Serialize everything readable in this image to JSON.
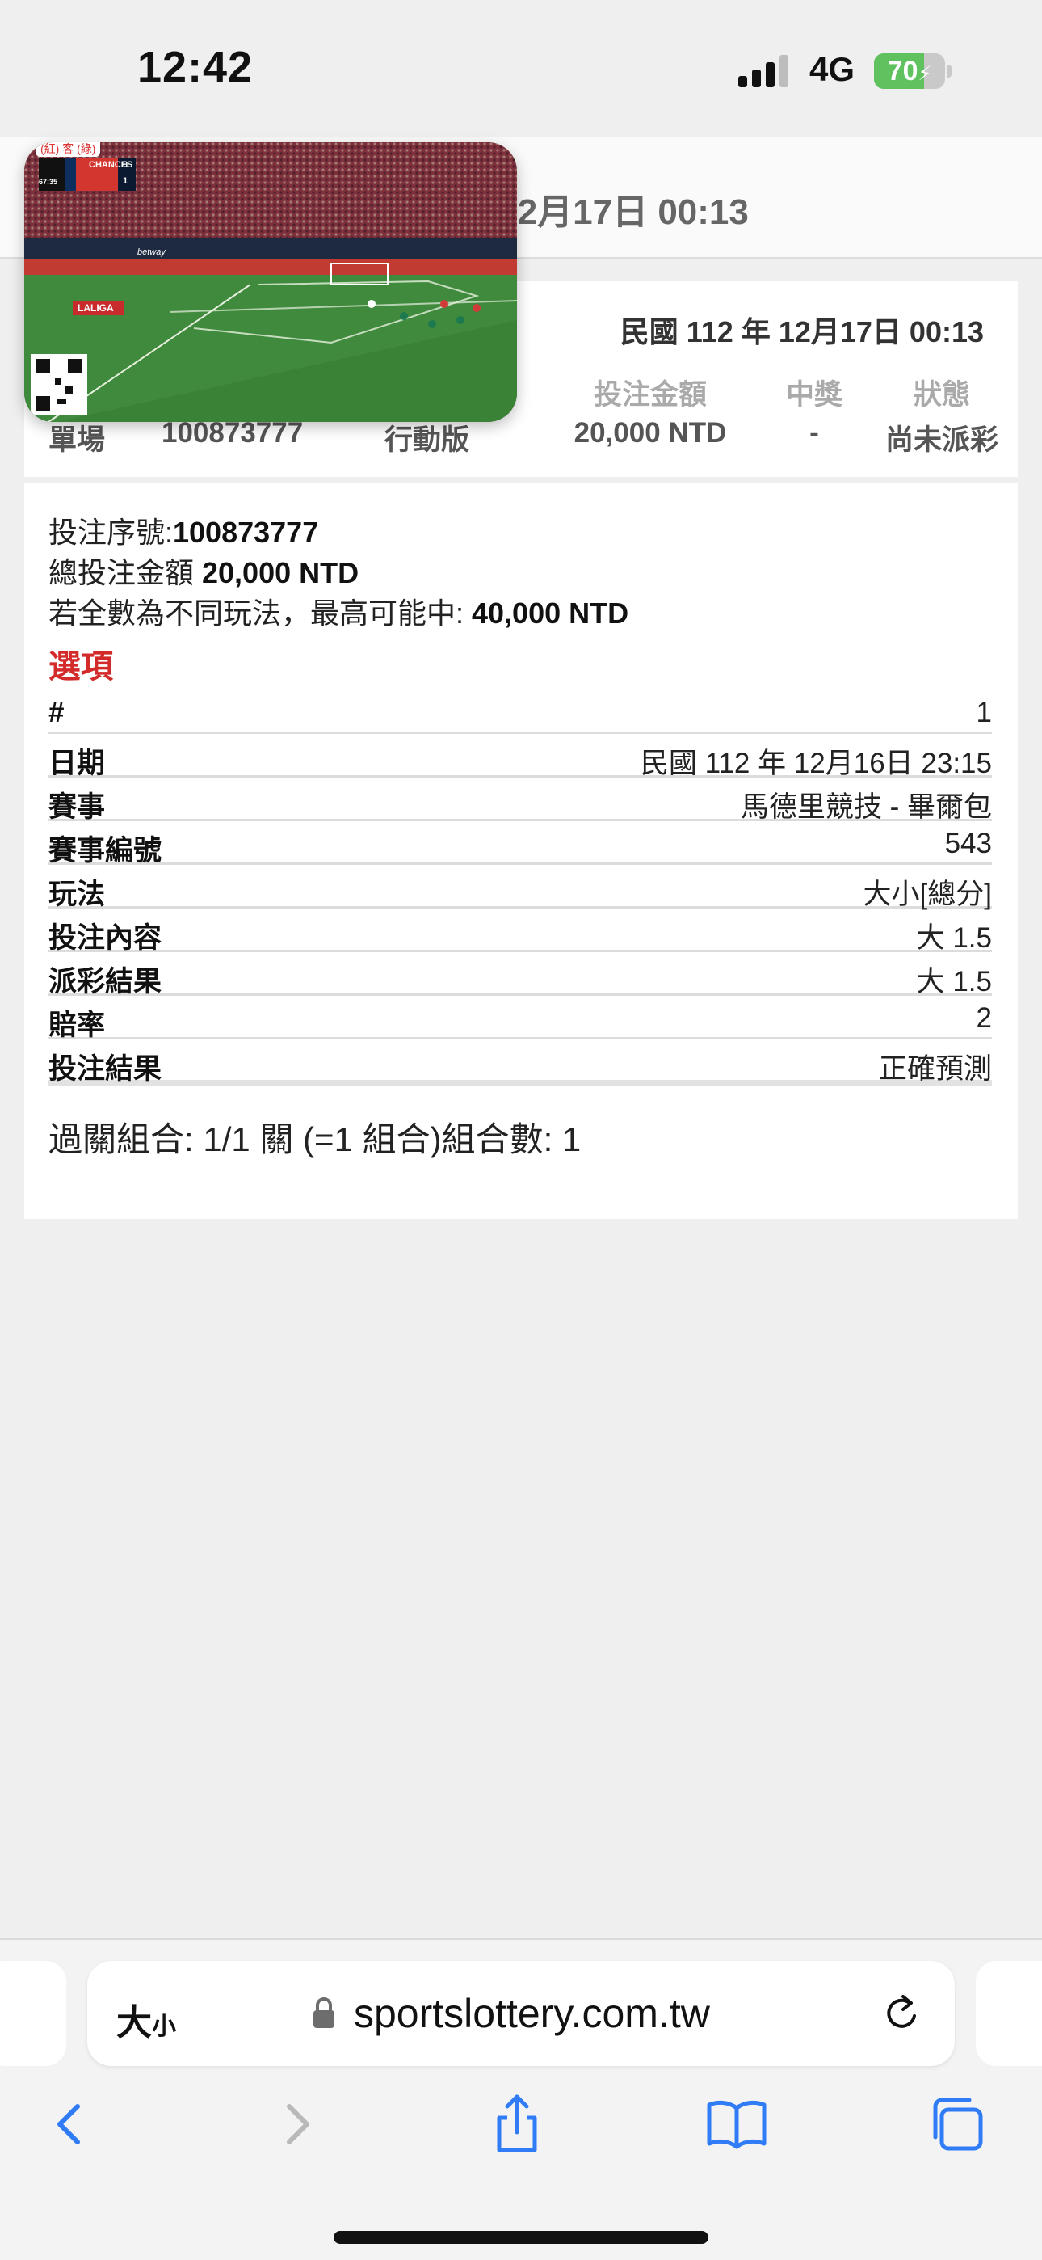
{
  "status_bar": {
    "time": "12:42",
    "network": "4G",
    "battery_level": 70,
    "battery_text": "70",
    "signal_icon": "cellular-signal-icon",
    "charging_icon": "bolt-icon"
  },
  "header": {
    "date_visible": "年 12月17日 00:13"
  },
  "summary": {
    "date": "民國 112 年 12月17日 00:13",
    "columns": {
      "amount": "投注金額",
      "prize": "中獎",
      "status": "狀態"
    },
    "row": {
      "type": "單場",
      "bet_number": "100873777",
      "channel": "行動版",
      "amount": "20,000 NTD",
      "prize": "-",
      "status": "尚未派彩"
    }
  },
  "detail": {
    "serial_label": "投注序號:",
    "serial_value": "100873777",
    "total_label": "總投注金額 ",
    "total_value": "20,000 NTD",
    "max_label": "若全數為不同玩法，最高可能中: ",
    "max_value": "40,000 NTD",
    "options_title": "選項",
    "options": [
      {
        "label": "#",
        "value": "1"
      },
      {
        "label": "日期",
        "value": "民國 112 年 12月16日 23:15"
      },
      {
        "label": "賽事",
        "value": "馬德里競技 - 畢爾包"
      },
      {
        "label": "賽事編號",
        "value": "543"
      },
      {
        "label": "玩法",
        "value": "大小[總分]"
      },
      {
        "label": "投注內容",
        "value": "大 1.5"
      },
      {
        "label": "派彩結果",
        "value": "大 1.5"
      },
      {
        "label": "賠率",
        "value": "2"
      },
      {
        "label": "投注結果",
        "value": "正確預測"
      }
    ],
    "parlay": "過關組合: 1/1 關 (=1 組合)組合數: 1"
  },
  "pip_video": {
    "corner_label": "(紅) 客 (綠)",
    "badge": "CHANCES",
    "clock": "67:35",
    "score_home": "0",
    "score_away": "1",
    "league": "LALIGA",
    "sponsor": "betway"
  },
  "browser": {
    "text_size_label": "大",
    "text_size_small": "小",
    "url": "sportslottery.com.tw"
  },
  "colors": {
    "accent_red": "#d32a2a",
    "battery_green": "#5fc25e",
    "ios_blue": "#2f7cf6"
  }
}
